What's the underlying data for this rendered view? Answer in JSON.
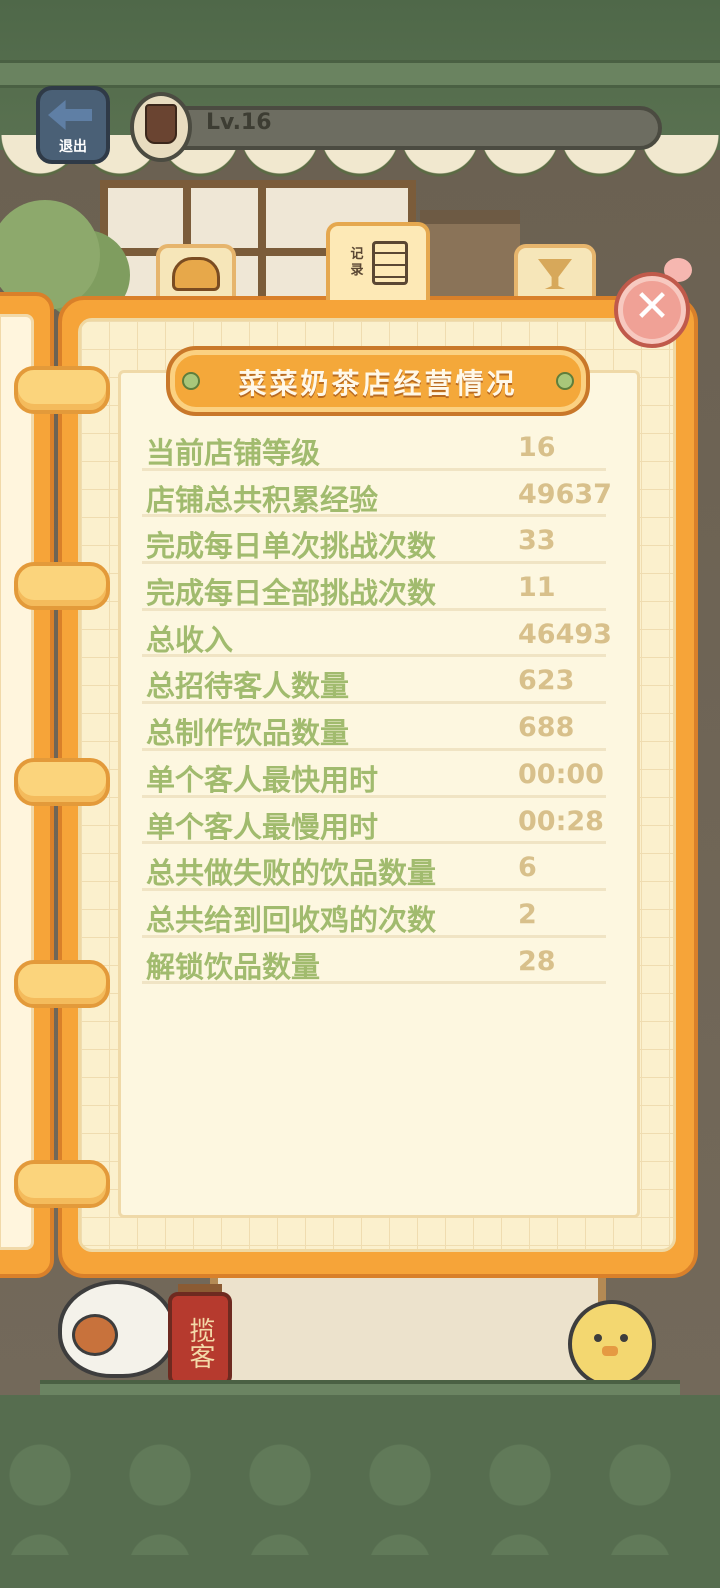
{
  "top_bar": {
    "exit_label": "退出",
    "level_text": "Lv.16"
  },
  "tabs": {
    "record_label": "记录"
  },
  "panel": {
    "title": "菜菜奶茶店经营情况",
    "stats": [
      {
        "label": "当前店铺等级",
        "value": "16"
      },
      {
        "label": "店铺总共积累经验",
        "value": "49637"
      },
      {
        "label": "完成每日单次挑战次数",
        "value": "33"
      },
      {
        "label": "完成每日全部挑战次数",
        "value": "11"
      },
      {
        "label": "总收入",
        "value": "46493"
      },
      {
        "label": "总招待客人数量",
        "value": "623"
      },
      {
        "label": "总制作饮品数量",
        "value": "688"
      },
      {
        "label": "单个客人最快用时",
        "value": "00:00"
      },
      {
        "label": "单个客人最慢用时",
        "value": "00:28"
      },
      {
        "label": "总共做失败的饮品数量",
        "value": "6"
      },
      {
        "label": "总共给到回收鸡的次数",
        "value": "2"
      },
      {
        "label": "解锁饮品数量",
        "value": "28"
      }
    ]
  },
  "scene": {
    "solicit_button": "揽客"
  },
  "icons": {
    "exit": "exit-arrow-icon",
    "level": "milk-tea-cup-icon",
    "tab_bread": "bread-icon",
    "tab_record": "clipboard-icon",
    "tab_drink": "cocktail-glass-icon",
    "close": "close-icon"
  },
  "colors": {
    "label_green": "#a1bb6e",
    "value_tan": "#d8c08b",
    "book_orange": "#f6a439",
    "paper": "#fdf7e0"
  }
}
